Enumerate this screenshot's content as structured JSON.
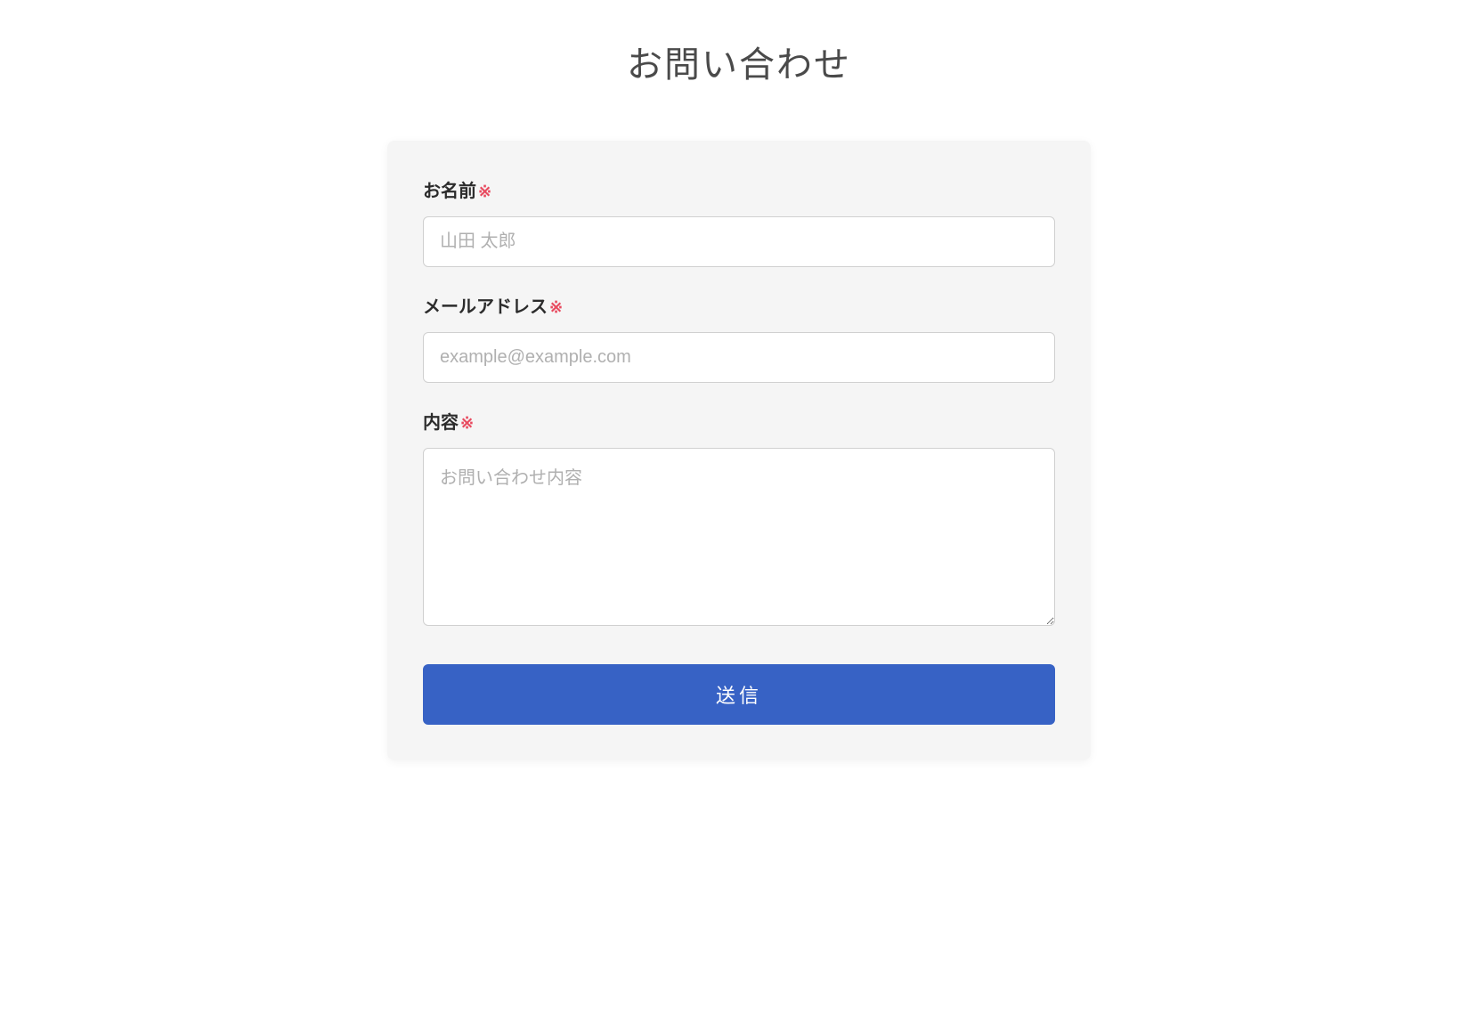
{
  "page": {
    "title": "お問い合わせ"
  },
  "form": {
    "name": {
      "label": "お名前",
      "placeholder": "山田 太郎",
      "value": ""
    },
    "email": {
      "label": "メールアドレス",
      "placeholder": "example@example.com",
      "value": ""
    },
    "message": {
      "label": "内容",
      "placeholder": "お問い合わせ内容",
      "value": ""
    },
    "required_mark": "※",
    "submit_label": "送信"
  }
}
